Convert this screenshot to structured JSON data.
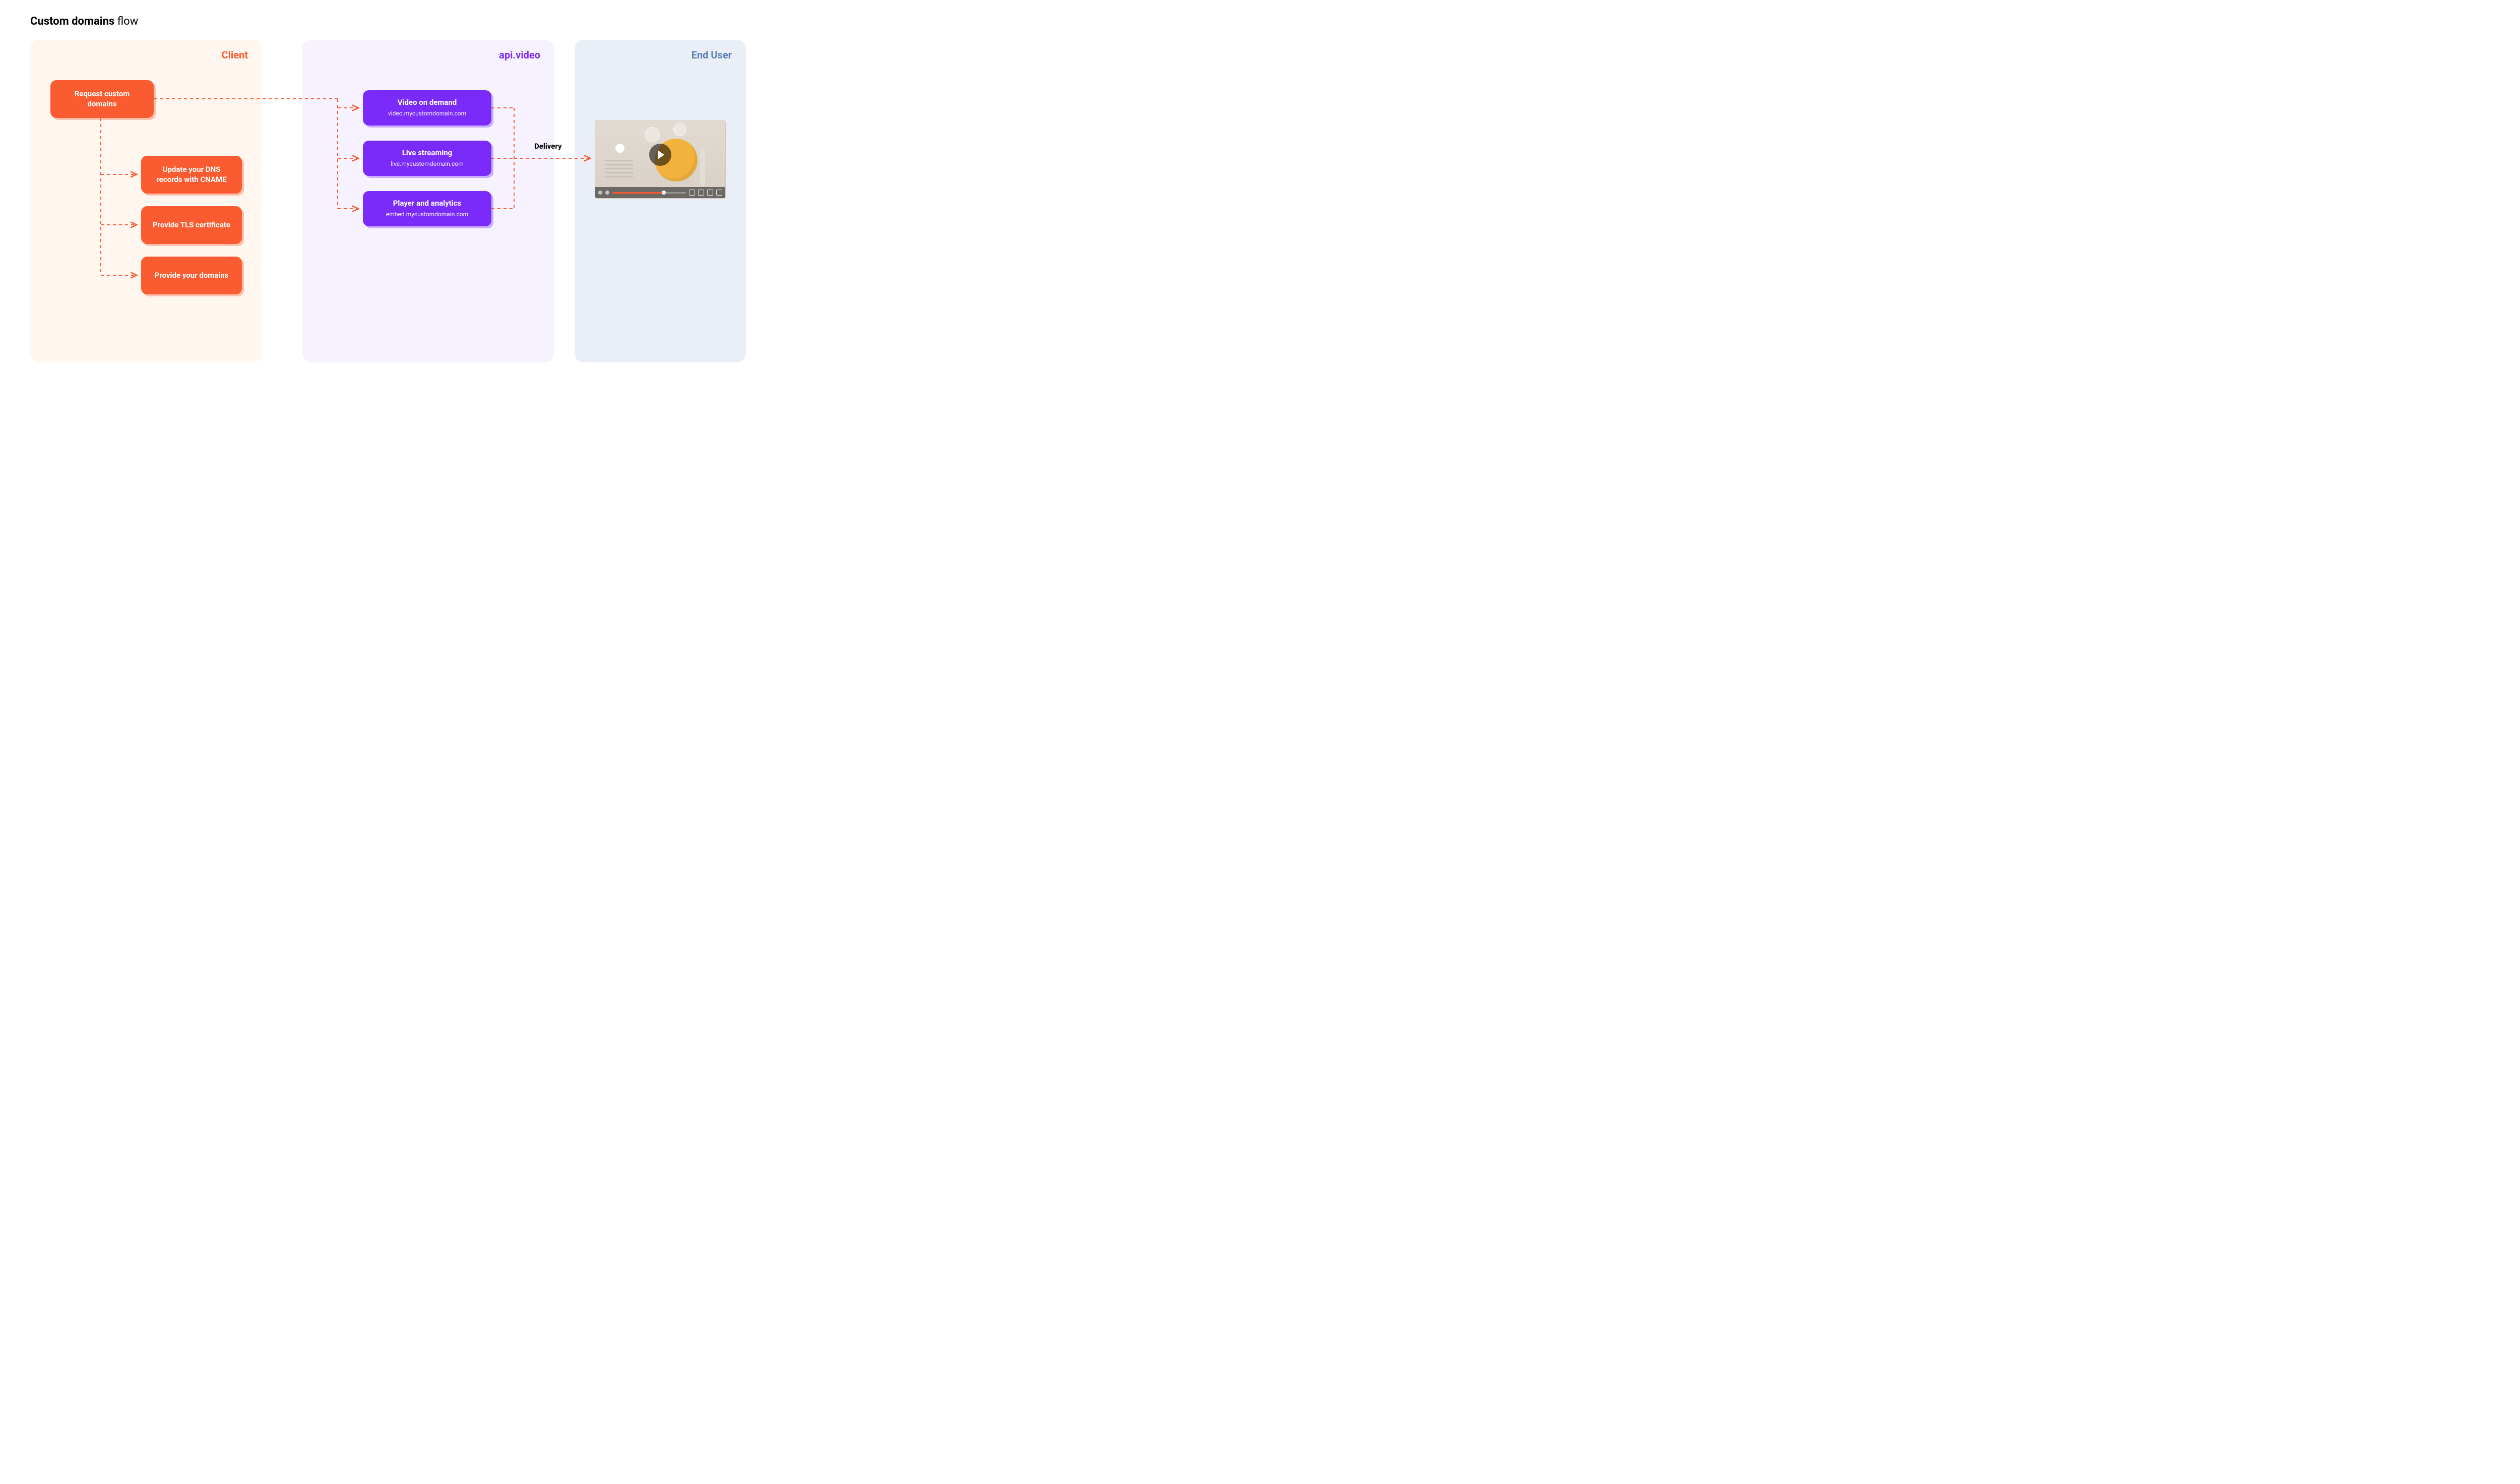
{
  "title": {
    "bold": "Custom domains",
    "light": " flow"
  },
  "panels": {
    "client": {
      "label": "Client"
    },
    "api": {
      "label": "api.video"
    },
    "enduser": {
      "label": "End User"
    }
  },
  "client_boxes": {
    "request": "Request custom domains",
    "dns": "Update your DNS records with CNAME",
    "tls": "Provide TLS certificate",
    "domains": "Provide your domains"
  },
  "api_boxes": {
    "vod": {
      "title": "Video on demand",
      "sub": "video.mycustomdomain.com"
    },
    "live": {
      "title": "Live streaming",
      "sub": "live.mycustomdomain.com"
    },
    "embed": {
      "title": "Player and analytics",
      "sub": "embed.mycustomdomain.com"
    }
  },
  "delivery_label": "Delivery",
  "colors": {
    "orange": "#FA5B30",
    "purple": "#7B2BF9",
    "blue": "#5B7DB1",
    "client_bg": "#FFF6F0",
    "api_bg": "#F6F2FF",
    "enduser_bg": "#EAEFF7"
  }
}
